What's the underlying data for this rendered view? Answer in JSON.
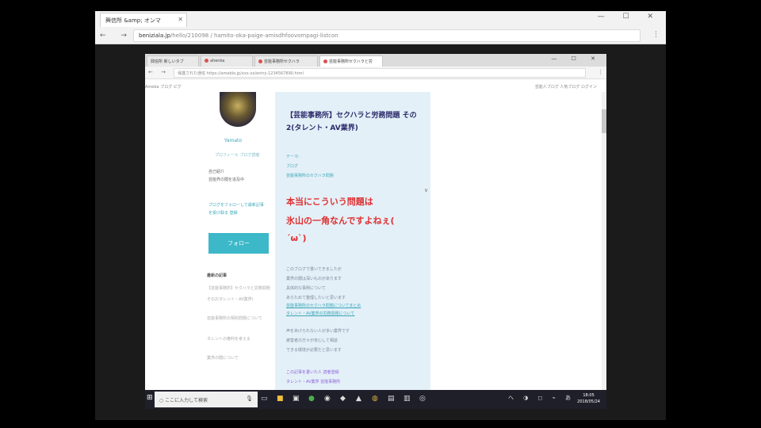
{
  "outer_browser": {
    "tab_title": "興信所 &amp; オンマ",
    "url_host": "beniziala.jp",
    "url_path": "/hello/210098 / hamito-oka-paige-amisdhfoovompagi-listcon",
    "window_controls": "— ☐ ✕",
    "nav": "← → C"
  },
  "remote": {
    "tabs": [
      "興信所 新しいタブ",
      "ahenka",
      "芸能事務所セクハラ",
      "芸能事務所セクハラと労"
    ],
    "window_controls": "— ☐ ✕",
    "url": "保護された通信  https://ameblo.jp/xxx-xx/entry-1234567890.html",
    "blogbar_left": "Ameba  ブログ  ピグ",
    "blogbar_right": "芸能人ブログ  人気ブログ  ログイン",
    "profile": {
      "name": "Yamato",
      "links": "プロフィール   ブログ読者",
      "bio": [
        "自己紹介",
        "芸能界の闇を追及中"
      ],
      "follow_info": [
        "ブログをフォローして最新記事",
        "を受け取る   登録"
      ],
      "follow_button": "フォロー",
      "recent_title": "最新の記事",
      "recent_items": [
        "【芸能事務所】セクハラと労務問題",
        "その2(タレント・AV業界)",
        "芸能事務所の契約問題について",
        "タレントの権利を考える",
        "業界の闇について"
      ]
    },
    "article": {
      "title": "【芸能事務所】セクハラと労務問題 その2(タレント・AV業界)",
      "meta": [
        "テーマ:",
        "ブログ",
        "芸能事務所のセクハラ問題"
      ],
      "collapse_icon": "∨",
      "red_lines": [
        "本当にこういう問題は",
        "氷山の一角なんですよねぇ(",
        "´ω`)"
      ],
      "body_lines_1": [
        "このブログで書いてきましたが",
        "業界の闇は深いものがあります",
        "具体的な事例について",
        "あらためて整理したいと思います"
      ],
      "link_lines": [
        "芸能事務所のセクハラ問題についてまとめ",
        "タレント・AV業界の労務問題について"
      ],
      "body_lines_2": [
        "声をあげられない人が多い業界です",
        "被害者の方々が安心して相談",
        "できる環境が必要だと思います"
      ],
      "purple_lines": [
        "この記事を書いた人 読者登録",
        "タレント・AV業界 芸能事務所"
      ]
    },
    "taskbar": {
      "search_placeholder": "ここに入力して検索",
      "tray": "へ ◑ ◻ ⌁ あ",
      "clock_time": "18:05",
      "clock_date": "2018/05/24"
    }
  },
  "colors": {
    "accent": "#3cb8c8",
    "article_bg": "#e4f0f8",
    "headline_red": "#e03030",
    "taskbar": "#1f1f2a"
  }
}
